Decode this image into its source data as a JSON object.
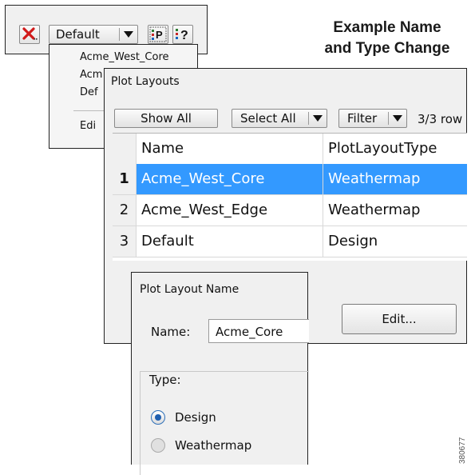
{
  "caption": {
    "line1": "Example Name",
    "line2": "and Type Change"
  },
  "toolbar": {
    "delete_icon": "red-x-icon",
    "selected_layout": "Default",
    "plot_properties_icon": "plot-properties-icon",
    "help_icon": "help-icon"
  },
  "dropdown_menu": {
    "items": [
      "Acme_West_Core",
      "Acm",
      "Def",
      "Edi"
    ]
  },
  "plot_layouts": {
    "title": "Plot Layouts",
    "show_all": "Show All",
    "select_all": "Select All",
    "filter": "Filter",
    "row_count": "3/3 row",
    "columns": {
      "index": "",
      "name": "Name",
      "type": "PlotLayoutType"
    },
    "rows": [
      {
        "index": "1",
        "name": "Acme_West_Core",
        "type": "Weathermap",
        "selected": true
      },
      {
        "index": "2",
        "name": "Acme_West_Edge",
        "type": "Weathermap",
        "selected": false
      },
      {
        "index": "3",
        "name": "Default",
        "type": "Design",
        "selected": false
      }
    ],
    "edit_button": "Edit..."
  },
  "name_panel": {
    "title": "Plot Layout Name",
    "name_label": "Name:",
    "name_value": "Acme_Core",
    "type_label": "Type:",
    "options": [
      {
        "label": "Design",
        "checked": true
      },
      {
        "label": "Weathermap",
        "checked": false
      }
    ]
  },
  "figure_id": "380677",
  "colors": {
    "selection": "#3399ff",
    "delete_red": "#d11a1a"
  }
}
